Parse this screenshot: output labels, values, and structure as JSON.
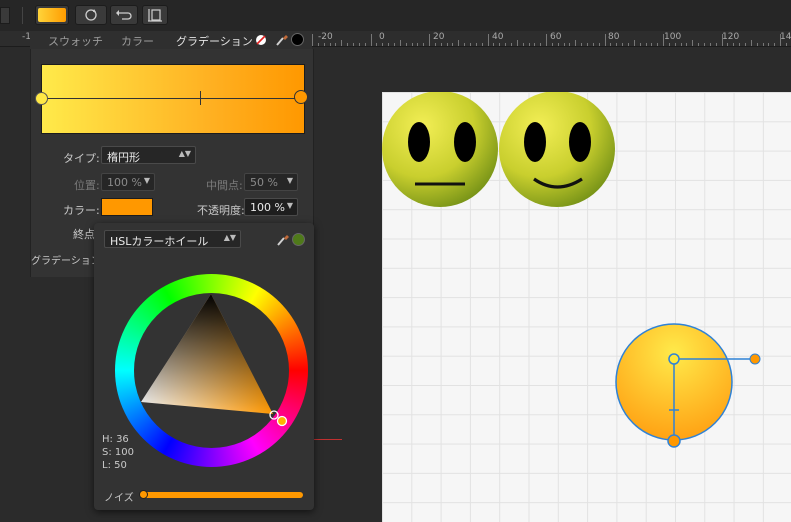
{
  "toolbar": {
    "fill_color": "#ffa800",
    "buttons": [
      "swap-icon",
      "refresh-icon",
      "undo-icon",
      "text-frame-icon"
    ]
  },
  "ruler": {
    "labels": [
      "-1",
      "-20",
      "0",
      "20",
      "40",
      "60",
      "80",
      "100",
      "120",
      "14"
    ]
  },
  "tabs": [
    {
      "label": "スウォッチ",
      "active": false
    },
    {
      "label": "カラー",
      "active": false
    },
    {
      "label": "グラデーション",
      "active": true
    }
  ],
  "gradient_panel": {
    "start_color": "#ffe845",
    "end_color": "#ff9800",
    "type_label": "タイプ:",
    "type_value": "楕円形",
    "position_label": "位置:",
    "position_value": "100 %",
    "midpoint_label": "中間点:",
    "midpoint_value": "50 %",
    "color_label": "カラー:",
    "color_value": "#ff9800",
    "opacity_label": "不透明度:",
    "opacity_value": "100 %",
    "end_label": "終点:",
    "gradient_label": "グラデーション"
  },
  "color_popup": {
    "mode": "HSLカラーホイール",
    "h_label": "H: 36",
    "s_label": "S: 100",
    "l_label": "L: 50",
    "noise_label": "ノイズ",
    "current_color": "#4f7a1a"
  },
  "colors": {
    "accent": "#ff9800",
    "canvas": "#f6f6f6",
    "selection": "#2f82d6"
  }
}
